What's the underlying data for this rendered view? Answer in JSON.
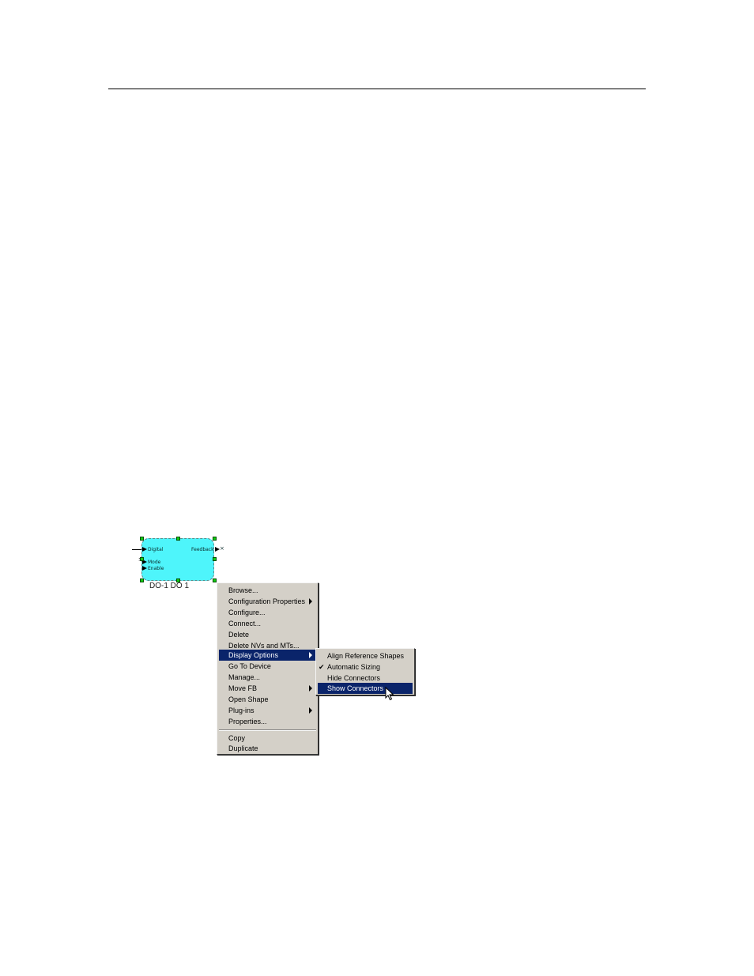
{
  "block": {
    "name_label": "DO-1 DO 1",
    "ports": {
      "digital": "Digital",
      "mode": "Mode",
      "enable": "Enable",
      "feedback": "Feedback"
    }
  },
  "context_menu": {
    "items": [
      {
        "label": "Browse...",
        "submenu": false
      },
      {
        "label": "Configuration Properties",
        "submenu": true
      },
      {
        "label": "Configure...",
        "submenu": false
      },
      {
        "label": "Connect...",
        "submenu": false
      },
      {
        "label": "Delete",
        "submenu": false
      },
      {
        "label": "Delete NVs and MTs...",
        "submenu": false
      },
      {
        "label": "Display Options",
        "submenu": true,
        "highlighted": true
      },
      {
        "label": "Go To Device",
        "submenu": false
      },
      {
        "label": "Manage...",
        "submenu": false
      },
      {
        "label": "Move FB",
        "submenu": true
      },
      {
        "label": "Open Shape",
        "submenu": false
      },
      {
        "label": "Plug-ins",
        "submenu": true
      },
      {
        "label": "Properties...",
        "submenu": false
      }
    ],
    "items_after_separator": [
      {
        "label": "Copy"
      },
      {
        "label": "Duplicate"
      }
    ]
  },
  "submenu": {
    "items": [
      {
        "label": "Align Reference Shapes",
        "checked": false
      },
      {
        "label": "Automatic Sizing",
        "checked": true
      },
      {
        "label": "Hide Connectors",
        "checked": false
      },
      {
        "label": "Show Connectors",
        "checked": false,
        "highlighted": true
      }
    ],
    "check_glyph": "✔"
  },
  "colors": {
    "menu_highlight": "#0a246a",
    "menu_background": "#d4d0c8",
    "block_fill": "#4ef5fb",
    "handle_green": "#11cc11"
  }
}
